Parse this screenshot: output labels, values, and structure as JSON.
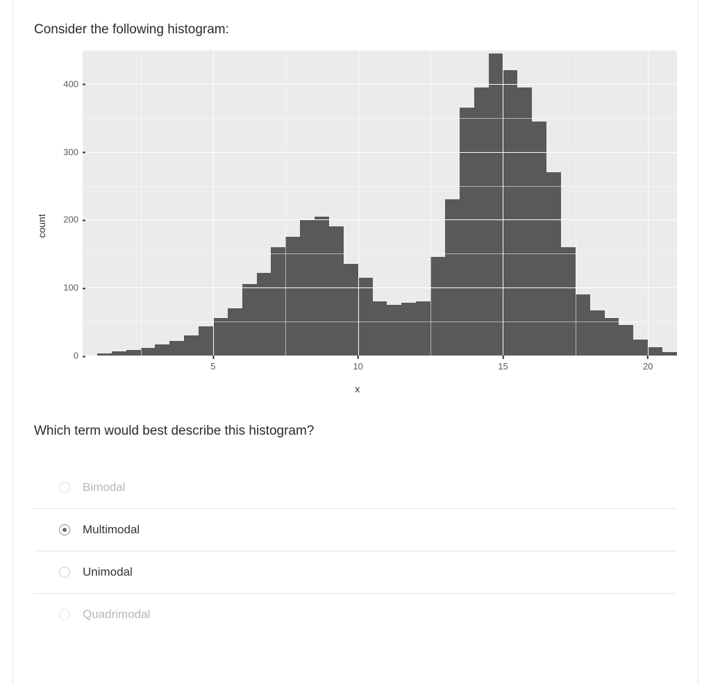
{
  "prompt": "Consider the following histogram:",
  "question": "Which term would best describe this histogram?",
  "chart_data": {
    "type": "bar",
    "xlabel": "x",
    "ylabel": "count",
    "ylim": [
      0,
      450
    ],
    "xlim": [
      0.5,
      21
    ],
    "yticks": [
      0,
      100,
      200,
      300,
      400
    ],
    "xticks": [
      5,
      10,
      15,
      20
    ],
    "yminor": [
      50,
      150,
      250,
      350,
      450
    ],
    "xminor": [
      2.5,
      7.5,
      12.5,
      17.5
    ],
    "x": [
      1,
      1.5,
      2,
      2.5,
      3,
      3.5,
      4,
      4.5,
      5,
      5.5,
      6,
      6.5,
      7,
      7.5,
      8,
      8.5,
      9,
      9.5,
      10,
      10.5,
      11,
      11.5,
      12,
      12.5,
      13,
      13.5,
      14,
      14.5,
      15,
      15.5,
      16,
      16.5,
      17,
      17.5,
      18,
      18.5,
      19,
      19.5,
      20,
      20.5,
      21
    ],
    "values": [
      0,
      3,
      6,
      8,
      11,
      16,
      22,
      30,
      43,
      55,
      70,
      105,
      122,
      160,
      175,
      200,
      205,
      190,
      135,
      115,
      80,
      75,
      78,
      80,
      145,
      230,
      365,
      395,
      445,
      420,
      395,
      345,
      270,
      160,
      90,
      66,
      55,
      45,
      24,
      12,
      5
    ]
  },
  "options": [
    {
      "label": "Bimodal",
      "selected": false,
      "faded": true
    },
    {
      "label": "Multimodal",
      "selected": true,
      "faded": false
    },
    {
      "label": "Unimodal",
      "selected": false,
      "faded": false
    },
    {
      "label": "Quadrimodal",
      "selected": false,
      "faded": true
    }
  ]
}
